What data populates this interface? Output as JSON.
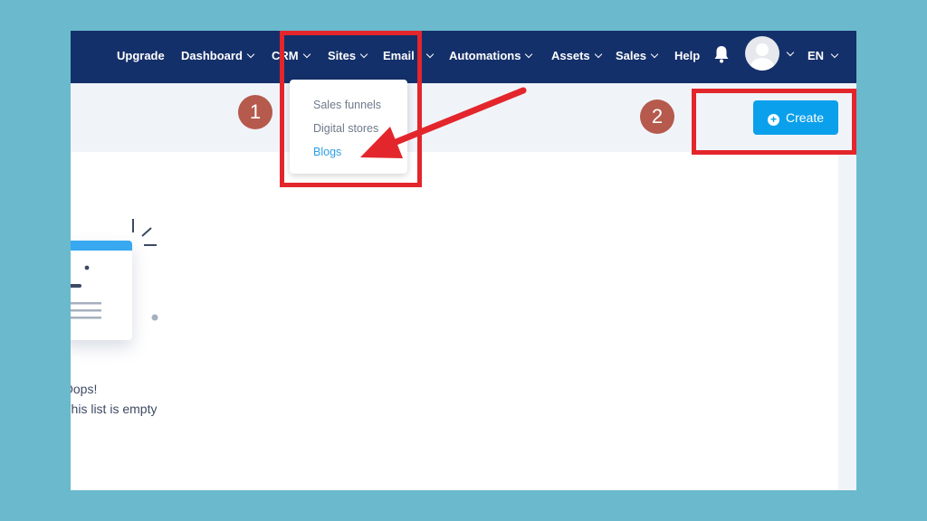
{
  "nav": {
    "upgrade": "Upgrade",
    "dashboard": "Dashboard",
    "crm": "CRM",
    "sites": "Sites",
    "email": "Email",
    "automations": "Automations",
    "assets": "Assets",
    "sales": "Sales",
    "help": "Help",
    "language": "EN"
  },
  "dropdown": {
    "items": [
      "Sales funnels",
      "Digital stores",
      "Blogs"
    ],
    "selected": "Blogs"
  },
  "toolbar": {
    "create_label": "Create"
  },
  "empty_state": {
    "title": "Oops!",
    "message": "This list is empty"
  },
  "annotations": {
    "step1": "1",
    "step2": "2"
  },
  "colors": {
    "background": "#6ab9cc",
    "topbar": "#14306a",
    "create_button": "#0aa0ec",
    "callout": "#e3262b",
    "badge": "#b55a4d",
    "link_active": "#2f9fe6"
  },
  "icons": [
    "bell-icon",
    "avatar-icon",
    "plus-circle-icon",
    "chevron-down-icon",
    "arrow-icon"
  ]
}
